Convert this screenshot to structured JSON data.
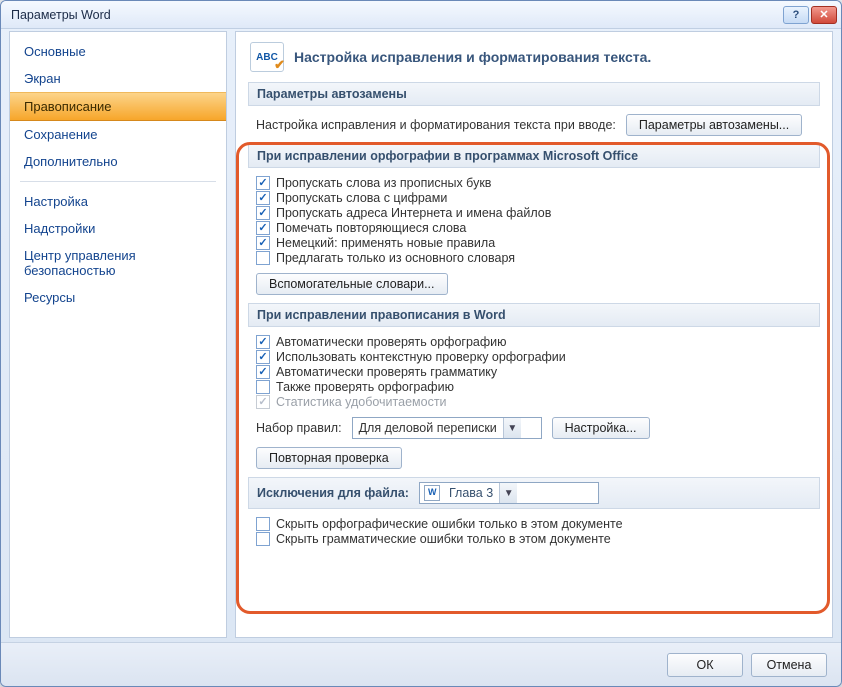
{
  "window": {
    "title": "Параметры Word"
  },
  "sidebar": {
    "items": [
      {
        "label": "Основные",
        "selected": false
      },
      {
        "label": "Экран",
        "selected": false
      },
      {
        "label": "Правописание",
        "selected": true
      },
      {
        "label": "Сохранение",
        "selected": false
      },
      {
        "label": "Дополнительно",
        "selected": false
      }
    ],
    "items2": [
      {
        "label": "Настройка"
      },
      {
        "label": "Надстройки"
      },
      {
        "label": "Центр управления безопасностью"
      },
      {
        "label": "Ресурсы"
      }
    ]
  },
  "header": {
    "icon_text": "ABC",
    "title": "Настройка исправления и форматирования текста."
  },
  "autocorrect": {
    "section": "Параметры автозамены",
    "desc": "Настройка исправления и форматирования текста при вводе:",
    "button": "Параметры автозамены..."
  },
  "spelling_office": {
    "section": "При исправлении орфографии в программах Microsoft Office",
    "opts": [
      {
        "label": "Пропускать слова из прописных букв",
        "checked": true
      },
      {
        "label": "Пропускать слова с цифрами",
        "checked": true
      },
      {
        "label": "Пропускать адреса Интернета и имена файлов",
        "checked": true
      },
      {
        "label": "Помечать повторяющиеся слова",
        "checked": true
      },
      {
        "label": "Немецкий: применять новые правила",
        "checked": true
      },
      {
        "label": "Предлагать только из основного словаря",
        "checked": false
      }
    ],
    "button": "Вспомогательные словари..."
  },
  "spelling_word": {
    "section": "При исправлении правописания в Word",
    "opts": [
      {
        "label": "Автоматически проверять орфографию",
        "checked": true
      },
      {
        "label": "Использовать контекстную проверку орфографии",
        "checked": true
      },
      {
        "label": "Автоматически проверять грамматику",
        "checked": true
      },
      {
        "label": "Также проверять орфографию",
        "checked": false
      },
      {
        "label": "Статистика удобочитаемости",
        "checked": true,
        "disabled": true
      }
    ],
    "ruleset_label": "Набор правил:",
    "ruleset_value": "Для деловой переписки",
    "settings_button": "Настройка...",
    "recheck_button": "Повторная проверка"
  },
  "exceptions": {
    "section_prefix": "Исключения для файла:",
    "file": "Глава 3",
    "opts": [
      {
        "label": "Скрыть орфографические ошибки только в этом документе",
        "checked": false
      },
      {
        "label": "Скрыть грамматические ошибки только в этом документе",
        "checked": false
      }
    ]
  },
  "footer": {
    "ok": "ОК",
    "cancel": "Отмена"
  }
}
